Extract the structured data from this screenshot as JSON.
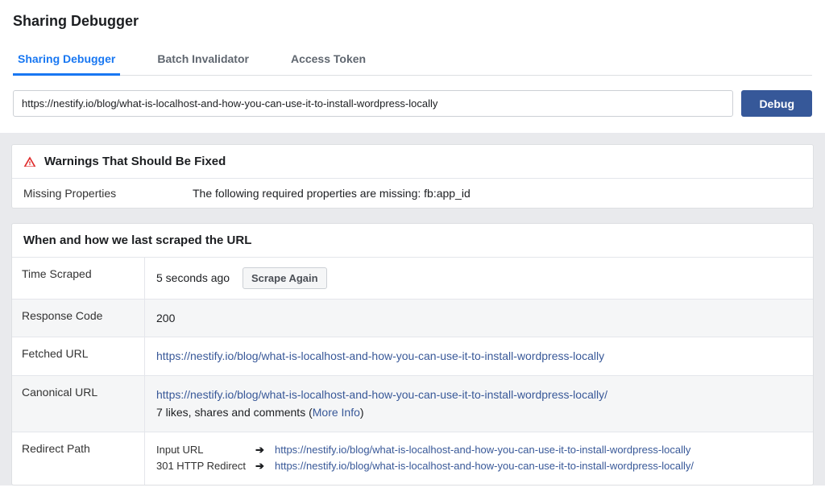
{
  "header": {
    "title": "Sharing Debugger"
  },
  "tabs": {
    "items": [
      {
        "label": "Sharing Debugger",
        "active": true
      },
      {
        "label": "Batch Invalidator",
        "active": false
      },
      {
        "label": "Access Token",
        "active": false
      }
    ]
  },
  "input": {
    "url_value": "https://nestify.io/blog/what-is-localhost-and-how-you-can-use-it-to-install-wordpress-locally",
    "debug_label": "Debug"
  },
  "warnings": {
    "heading": "Warnings That Should Be Fixed",
    "rows": [
      {
        "label": "Missing Properties",
        "value": "The following required properties are missing: fb:app_id"
      }
    ]
  },
  "scrape": {
    "heading": "When and how we last scraped the URL",
    "time_label": "Time Scraped",
    "time_value": "5 seconds ago",
    "scrape_again_label": "Scrape Again",
    "response_label": "Response Code",
    "response_value": "200",
    "fetched_label": "Fetched URL",
    "fetched_url": "https://nestify.io/blog/what-is-localhost-and-how-you-can-use-it-to-install-wordpress-locally",
    "canonical_label": "Canonical URL",
    "canonical_url": "https://nestify.io/blog/what-is-localhost-and-how-you-can-use-it-to-install-wordpress-locally/",
    "canonical_stats_prefix": "7 likes, shares and comments (",
    "more_info_label": "More Info",
    "canonical_stats_suffix": ")",
    "redirect_label": "Redirect Path",
    "redirect_items": [
      {
        "label": "Input URL",
        "url": "https://nestify.io/blog/what-is-localhost-and-how-you-can-use-it-to-install-wordpress-locally"
      },
      {
        "label": "301 HTTP Redirect",
        "url": "https://nestify.io/blog/what-is-localhost-and-how-you-can-use-it-to-install-wordpress-locally/"
      }
    ]
  }
}
